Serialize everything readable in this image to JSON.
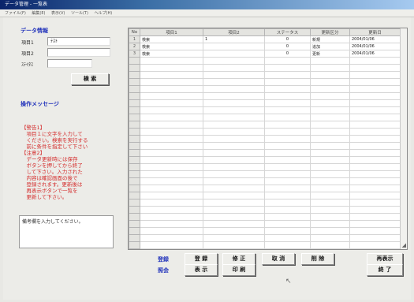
{
  "window": {
    "title": "データ管理 - 一覧表",
    "menu": [
      "ファイル(F)",
      "編集(E)",
      "表示(V)",
      "ツール(T)",
      "ヘルプ(H)"
    ]
  },
  "data_info": {
    "title": "データ情報",
    "fields": [
      {
        "label": "項目1",
        "value": "ﾃｽﾄ"
      },
      {
        "label": "項目2",
        "value": ""
      },
      {
        "label": "ｽﾃｲﾀｽ",
        "value": ""
      }
    ],
    "search_button": "検 索"
  },
  "messages": {
    "title": "操作メッセージ",
    "lines": [
      "【警告1】",
      "　項目１に文字を入力して",
      "　ください。検索を実行する",
      "　前に条件を指定して下さい",
      "【注意2】",
      "　データ更新時には保存",
      "　ボタンを押してから終了",
      "　して下さい。入力された",
      "　内容は確認画面の後で",
      "　登録されます。更新後は",
      "　再表示ボタンで一覧を",
      "　更新して下さい。"
    ]
  },
  "notes": {
    "text": "備考欄を入力してください。"
  },
  "grid": {
    "columns": [
      "No",
      "項目1",
      "項目2",
      "ステータス",
      "更新区分",
      "更新日"
    ],
    "rows": [
      [
        "1",
        "検索",
        "1",
        "0",
        "新規",
        "2004/01/06"
      ],
      [
        "2",
        "検索",
        "",
        "0",
        "追加",
        "2004/01/06"
      ],
      [
        "3",
        "検索",
        "",
        "0",
        "更新",
        "2004/01/06"
      ]
    ],
    "empty_rows": 27
  },
  "actions": {
    "group1_label": "登録",
    "group2_label": "照会",
    "row1": [
      "登 録",
      "修 正",
      "取 消",
      "削 除"
    ],
    "row2": [
      "表 示",
      "印 刷"
    ],
    "extra_button": "再表示",
    "close_button": "終 了"
  }
}
